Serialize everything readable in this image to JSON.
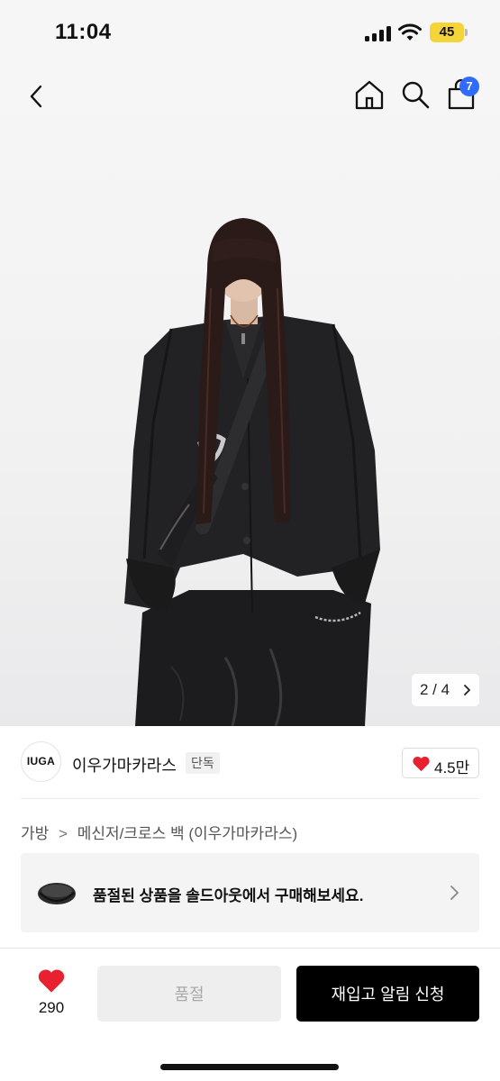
{
  "status_bar": {
    "time": "11:04",
    "battery": "45"
  },
  "nav": {
    "cart_count": "7"
  },
  "gallery": {
    "current": "2 / 4"
  },
  "brand": {
    "logo_text": "IUGA",
    "name": "이우가마카라스",
    "badge": "단독",
    "likes": "4.5만"
  },
  "breadcrumb": {
    "items": [
      "가방",
      "메신저/크로스 백 (이우가마카라스)"
    ],
    "separator": ">"
  },
  "promo": {
    "text": "품절된 상품을 솔드아웃에서 구매해보세요."
  },
  "bottom_bar": {
    "wish_count": "290",
    "soldout_label": "품절",
    "restock_label": "재입고 알림 신청"
  },
  "colors": {
    "accent_blue": "#2f6bff",
    "heart_red": "#e8202f",
    "primary": "#000000"
  },
  "icons": [
    "back-arrow-icon",
    "home-icon",
    "search-icon",
    "shopping-bag-icon",
    "heart-icon",
    "chevron-right-icon"
  ]
}
